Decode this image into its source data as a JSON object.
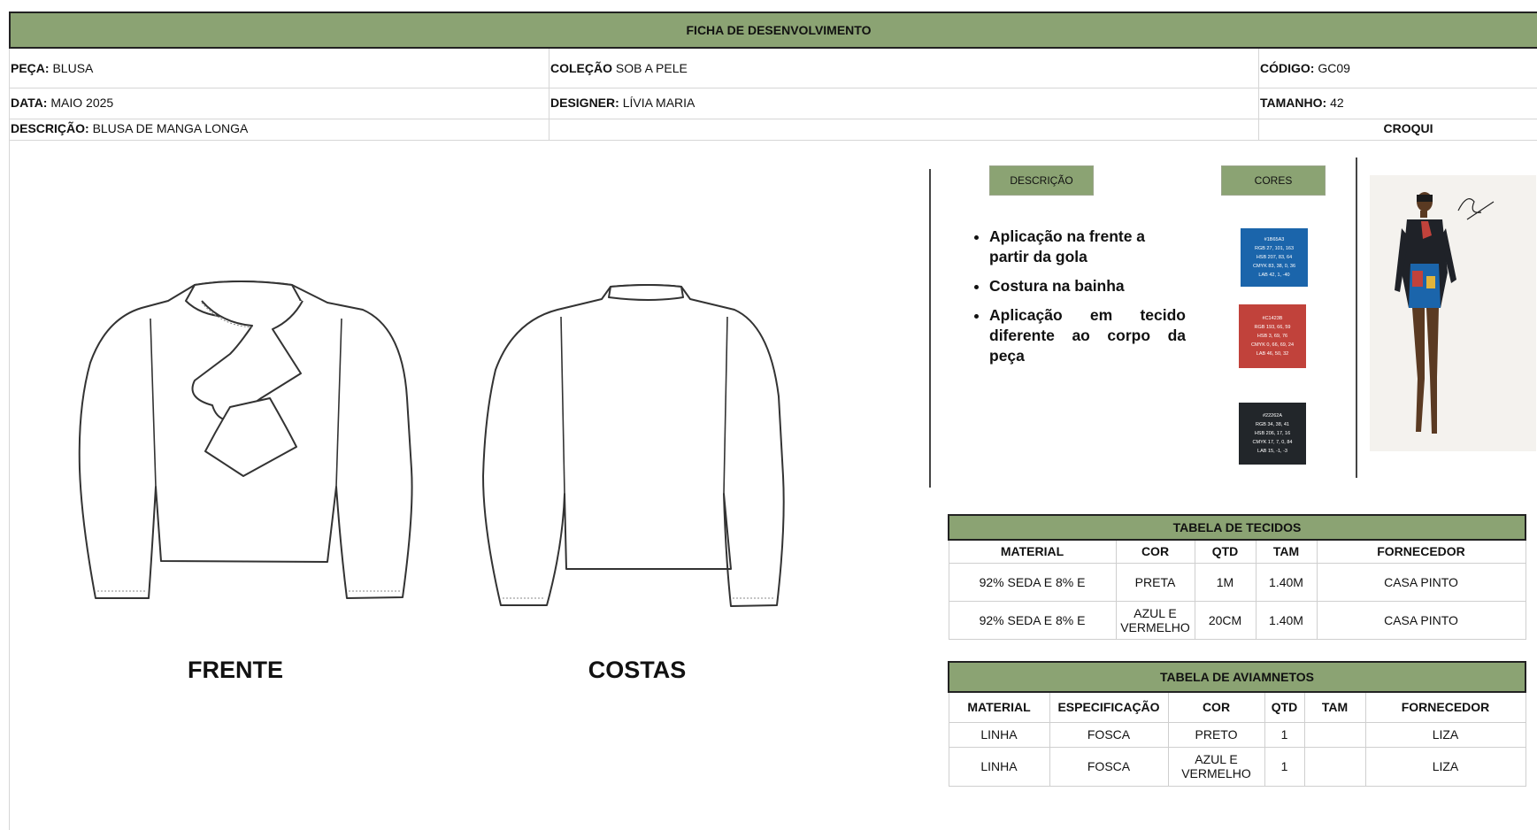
{
  "title": "FICHA DE DESENVOLVIMENTO",
  "fields": {
    "peca": {
      "label": "PEÇA:",
      "value": "BLUSA"
    },
    "colecao": {
      "label": "COLEÇÃO",
      "value": "SOB A PELE"
    },
    "codigo": {
      "label": "CÓDIGO:",
      "value": "GC09"
    },
    "data": {
      "label": "DATA:",
      "value": "MAIO 2025"
    },
    "designer": {
      "label": "DESIGNER:",
      "value": "LÍVIA MARIA"
    },
    "tamanho": {
      "label": "TAMANHO:",
      "value": "42"
    },
    "descricao": {
      "label": "DESCRIÇÃO:",
      "value": "BLUSA DE MANGA LONGA"
    },
    "croqui": "CROQUI"
  },
  "views": {
    "front": "FRENTE",
    "back": "COSTAS"
  },
  "panel": {
    "descricao_head": "DESCRIÇÃO",
    "cores_head": "CORES",
    "bullets": [
      "Aplicação na frente a partir da gola",
      "Costura na bainha",
      "Aplicação em tecido diferente ao corpo da peça"
    ]
  },
  "colors": [
    {
      "hex": "#1b65ab",
      "lines": [
        "#1B65A3",
        "RGB 27, 101, 163",
        "HSB 207, 83, 64",
        "CMYK 83, 38, 0, 36",
        "LAB 42, 1, -40"
      ]
    },
    {
      "hex": "#c1423b",
      "lines": [
        "#C1423B",
        "RGB 193, 66, 59",
        "HSB 3, 69, 76",
        "CMYK 0, 66, 69, 24",
        "LAB 46, 50, 32"
      ]
    },
    {
      "hex": "#22262a",
      "lines": [
        "#22262A",
        "RGB 34, 38, 41",
        "HSB 206, 17, 16",
        "CMYK 17, 7, 0, 84",
        "LAB 15, -1, -3"
      ]
    }
  ],
  "tecidos": {
    "caption": "TABELA DE TECIDOS",
    "headers": [
      "MATERIAL",
      "COR",
      "QTD",
      "TAM",
      "FORNECEDOR"
    ],
    "rows": [
      [
        "92% SEDA E 8% E",
        "PRETA",
        "1M",
        "1.40M",
        "CASA PINTO"
      ],
      [
        "92% SEDA E 8% E",
        "AZUL E VERMELHO",
        "20CM",
        "1.40M",
        "CASA PINTO"
      ]
    ]
  },
  "aviamentos": {
    "caption": "TABELA DE AVIAMNETOS",
    "headers": [
      "MATERIAL",
      "ESPECIFICAÇÃO",
      "COR",
      "QTD",
      "TAM",
      "FORNECEDOR"
    ],
    "rows": [
      [
        "LINHA",
        "FOSCA",
        "PRETO",
        "1",
        "",
        "LIZA"
      ],
      [
        "LINHA",
        "FOSCA",
        "AZUL E VERMELHO",
        "1",
        "",
        "LIZA"
      ]
    ]
  },
  "accent": "#8ba373"
}
